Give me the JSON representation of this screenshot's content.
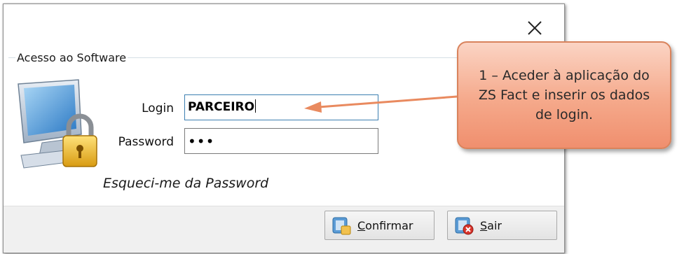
{
  "window": {
    "close_glyph": "✕"
  },
  "group": {
    "title": "Acesso ao Software"
  },
  "form": {
    "login_label": "Login",
    "login_value": "PARCEIRO",
    "password_label": "Password",
    "password_value": "•••",
    "forgot_link": "Esqueci-me da Password"
  },
  "buttons": {
    "confirm_accel": "C",
    "confirm_rest": "onfirmar",
    "exit_accel": "S",
    "exit_rest": "air"
  },
  "callout": {
    "text": "1 – Aceder à aplicação do ZS Fact e  inserir os dados de login."
  },
  "colors": {
    "callout_fill": "#f5a98b",
    "callout_border": "#d9835c",
    "arrow": "#e98a5f",
    "focus_border": "#3c7fb1"
  },
  "icons": {
    "close": "close-icon",
    "computer_lock": "computer-lock-icon",
    "confirm": "confirm-icon",
    "exit": "exit-icon"
  }
}
